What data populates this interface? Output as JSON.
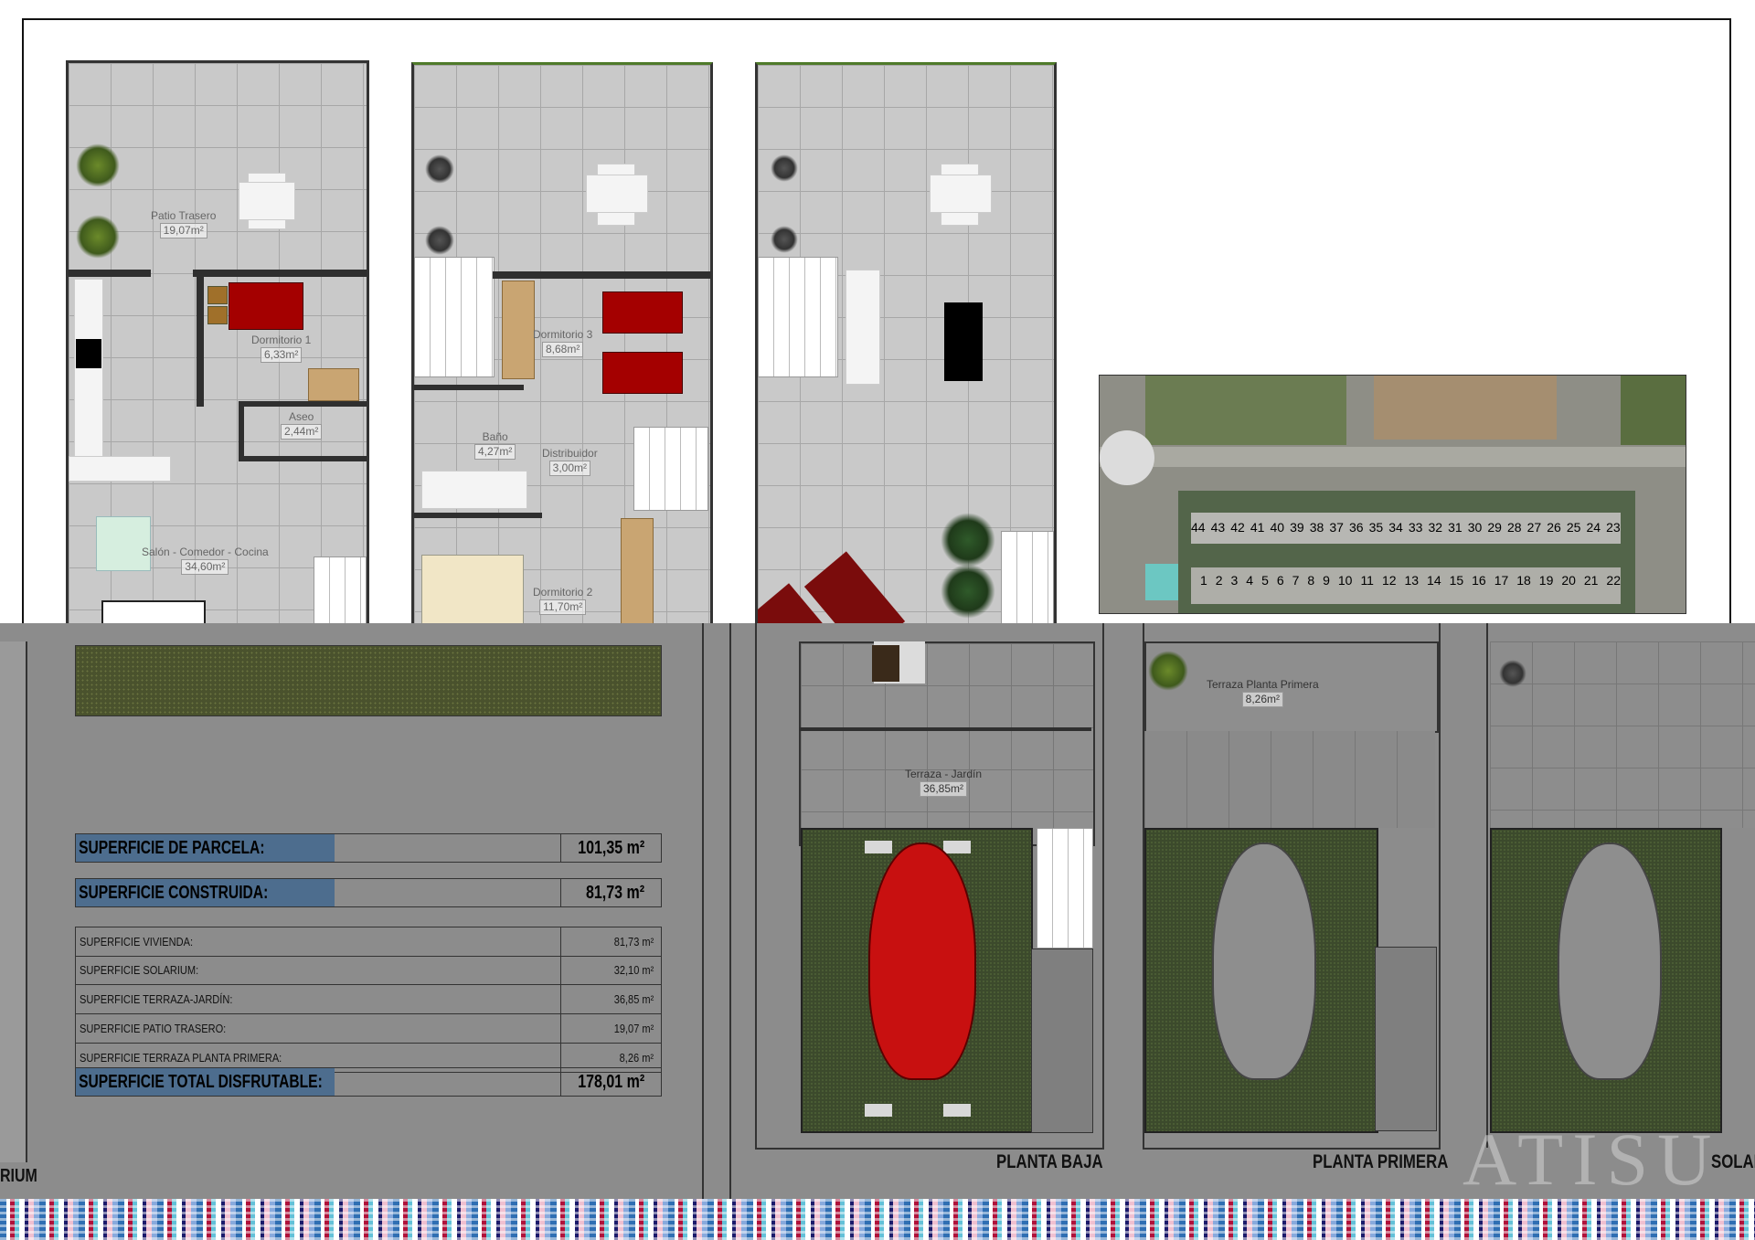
{
  "plans": {
    "ground": {
      "patio": {
        "name": "Patio Trasero",
        "area": "19,07m²"
      },
      "dorm1": {
        "name": "Dormitorio 1",
        "area": "6,33m²"
      },
      "aseo": {
        "name": "Aseo",
        "area": "2,44m²"
      },
      "salon": {
        "name": "Salón - Comedor - Cocina",
        "area": "34,60m²"
      }
    },
    "first": {
      "dorm3": {
        "name": "Dormitorio 3",
        "area": "8,68m²"
      },
      "bano": {
        "name": "Baño",
        "area": "4,27m²"
      },
      "distribuidor": {
        "name": "Distribuidor",
        "area": "3,00m²"
      },
      "dorm2": {
        "name": "Dormitorio 2",
        "area": "11,70m²"
      }
    }
  },
  "aerial": {
    "units_top": [
      "44",
      "43",
      "42",
      "41",
      "40",
      "39",
      "38",
      "37",
      "36",
      "35",
      "34",
      "33",
      "32",
      "31",
      "30",
      "29",
      "28",
      "27",
      "26",
      "25",
      "24",
      "23"
    ],
    "units_bottom": [
      "1",
      "2",
      "3",
      "4",
      "5",
      "6",
      "7",
      "8",
      "9",
      "10",
      "11",
      "12",
      "13",
      "14",
      "15",
      "16",
      "17",
      "18",
      "19",
      "20",
      "21",
      "22"
    ]
  },
  "summary": {
    "parcela": {
      "label": "SUPERFICIE DE PARCELA:",
      "value": "101,35 m²"
    },
    "construida": {
      "label": "SUPERFICIE CONSTRUIDA:",
      "value": "81,73 m²"
    },
    "rows": [
      {
        "label": "SUPERFICIE VIVIENDA:",
        "value": "81,73 m²"
      },
      {
        "label": "SUPERFICIE SOLARIUM:",
        "value": "32,10 m²"
      },
      {
        "label": "SUPERFICIE TERRAZA-JARDÍN:",
        "value": "36,85 m²"
      },
      {
        "label": "SUPERFICIE PATIO TRASERO:",
        "value": "19,07 m²"
      },
      {
        "label": "SUPERFICIE TERRAZA PLANTA PRIMERA:",
        "value": "8,26 m²"
      }
    ],
    "total": {
      "label": "SUPERFICIE TOTAL DISFRUTABLE:",
      "value": "178,01 m²"
    }
  },
  "bottom_plans": {
    "terraza_jardin": {
      "name": "Terraza - Jardín",
      "area": "36,85m²"
    },
    "terraza_primera": {
      "name": "Terraza Planta Primera",
      "area": "8,26m²"
    }
  },
  "captions": {
    "left_partial": "RIUM",
    "planta_baja": "PLANTA BAJA",
    "planta_primera": "PLANTA PRIMERA",
    "right_partial": "SOLAR",
    "watermark": "ATISU"
  },
  "colors": {
    "highlight": "#4d6d8e",
    "bed": "#a40000",
    "car": "#c81010"
  }
}
